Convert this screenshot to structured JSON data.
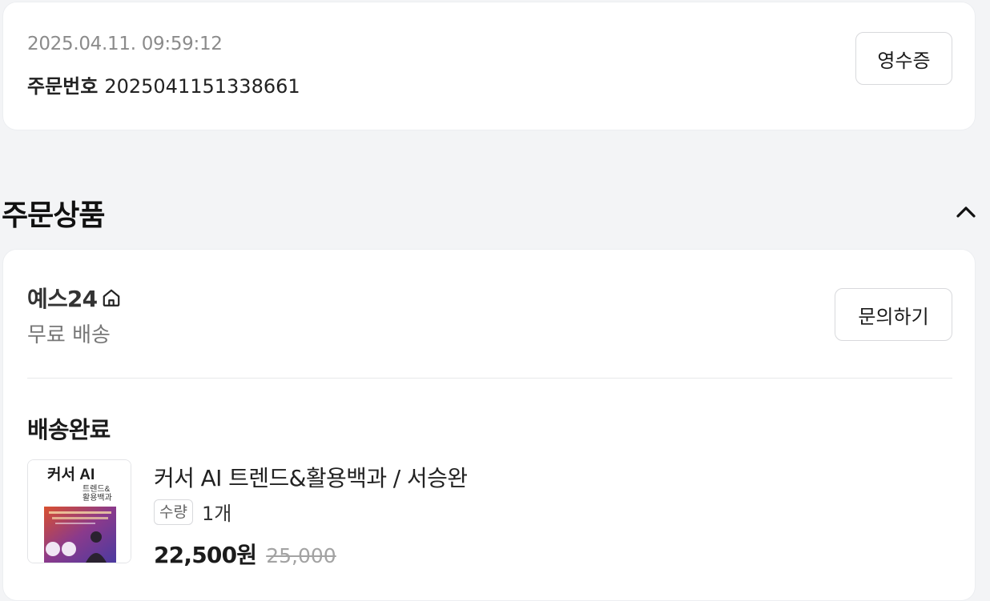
{
  "order": {
    "datetime": "2025.04.11. 09:59:12",
    "number_label": "주문번호",
    "number": "2025041151338661",
    "receipt_button": "영수증"
  },
  "section": {
    "title": "주문상품",
    "toggle_icon": "chevron-up-icon"
  },
  "seller": {
    "name": "예스24",
    "icon": "home-icon",
    "shipping": "무료 배송",
    "inquiry_button": "문의하기"
  },
  "delivery": {
    "status": "배송완료"
  },
  "product": {
    "title": "커서 AI 트렌드&활용백과 / 서승완",
    "qty_label": "수량",
    "qty_value": "1개",
    "sale_price": "22,500원",
    "original_price": "25,000",
    "thumbnail": {
      "cover_title": "커서 AI",
      "cover_subtitle_1": "트렌드&",
      "cover_subtitle_2": "활용백과"
    }
  },
  "colors": {
    "background": "#f3f4f6",
    "card": "#ffffff",
    "muted_text": "#8b8b8b"
  }
}
